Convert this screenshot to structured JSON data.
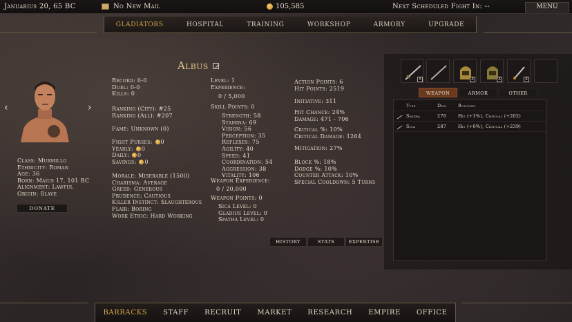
{
  "topbar": {
    "date": "Januarius 20, 65 BC",
    "mail": "No New Mail",
    "gold": "105,585",
    "next_fight": "Next Scheduled Fight In: --",
    "menu": "MENU"
  },
  "topnav": [
    "GLADIATORS",
    "HOSPITAL",
    "TRAINING",
    "WORKSHOP",
    "ARMORY",
    "UPGRADE"
  ],
  "gladiator": {
    "name": "Albus",
    "bio": [
      "Class: Murmillo",
      "Ethnicity: Roman",
      "Age: 36",
      "Born: Maius 17, 101 BC",
      "Alignment: Lawful",
      "Origin: Slave"
    ],
    "donate": "DONATE",
    "record": [
      "Record: 0-0",
      "Duel: 0-0",
      "Kills: 0"
    ],
    "ranking": [
      "Ranking (City): #25",
      "Ranking (All): #207"
    ],
    "fame": "Fame: Unknown (0)",
    "purses_title": "Fight Purses:",
    "purses_value": "0",
    "yearly_label": "Yearly:",
    "yearly_value": "0",
    "daily_label": "Daily:",
    "daily_value": "0",
    "savings_label": "Savings:",
    "savings_value": "0",
    "traits": [
      "Morale: Miserable (1500)",
      "Charisma: Average",
      "Greed: Generous",
      "Prudence: Cautious",
      "Killer Instinct: Slaughterous",
      "Flair: Boring",
      "Work Ethic: Hard Working"
    ],
    "level": "Level: 1",
    "experience_label": "Experience:",
    "experience_value": "0 / 5,000",
    "skill_points": "Skill Points: 0",
    "attributes": [
      "Strength: 58",
      "Stamina: 69",
      "Vision: 56",
      "Perception: 35",
      "Reflexes: 75",
      "Agility: 40",
      "Speed: 41",
      "Coordination: 54",
      "Aggression: 38",
      "Vitality: 106"
    ],
    "weapon_experience_label": "Weapon Experience:",
    "weapon_experience_value": "0 / 20,000",
    "weapon_points": "Weapon Points: 0",
    "weapon_levels": [
      "Sica Level: 0",
      "Gladius Level: 0",
      "Spatha Level: 0"
    ],
    "combat1": [
      "Action Points: 6",
      "Hit Points: 2519"
    ],
    "initiative": "Initiative: 311",
    "combat2": [
      "Hit Chance: 24%",
      "Damage: 471 - 706"
    ],
    "combat3": [
      "Critical %: 10%",
      "Critical Damage: 1264"
    ],
    "mitigation": "Mitigation: 27%",
    "combat4": [
      "Block %: 18%",
      "Dodge %: 10%",
      "Counter Attack: 10%",
      "Special Cooldown: 5 Turns"
    ]
  },
  "midtabs": [
    "HISTORY",
    "STATS",
    "EXPERTISE"
  ],
  "equipment": {
    "close_label": "X",
    "tabs": [
      "WEAPON",
      "ARMOR",
      "OTHER"
    ],
    "columns": [
      "Type",
      "Dmg",
      "Bonuses"
    ],
    "rows": [
      {
        "type": "Spatha",
        "dmg": "276",
        "bonuses": "Hit (+1%), Critical (+202)"
      },
      {
        "type": "Sica",
        "dmg": "287",
        "bonuses": "Hit (+6%), Critical (+239)"
      }
    ]
  },
  "botnav": [
    "BARRACKS",
    "STAFF",
    "RECRUIT",
    "MARKET",
    "RESEARCH",
    "EMPIRE",
    "OFFICE"
  ]
}
